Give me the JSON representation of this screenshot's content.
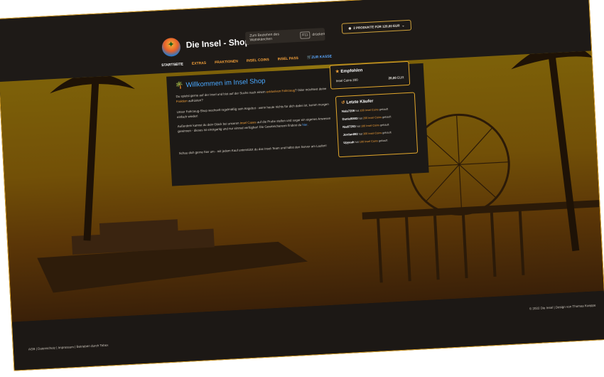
{
  "header": {
    "brand": "Die Insel - Shop",
    "logo_icon": "palm-island-logo-icon",
    "wd_text": "Zum Beziehen des Wattskänchen",
    "wd_key": "F11",
    "wd_suffix": "drücken",
    "cart_label": "2 PRODUKTE FÜR 120,00 EUR"
  },
  "nav": {
    "items": [
      {
        "label": "STARTSEITE"
      },
      {
        "label": "EXTRAS"
      },
      {
        "label": "FRAKTIONEN"
      },
      {
        "label": "INSEL COINS"
      },
      {
        "label": "INSEL PASS"
      },
      {
        "label": "ZUR KASSE"
      }
    ]
  },
  "welcome": {
    "title": "Willkommen im Insel Shop",
    "p1a": "Du spielst gerne auf der Insel und bist auf der Suche nach einem ",
    "p1link": "exklusiven Fahrzeug",
    "p1b": "? Oder möchtest deine ",
    "p1link2": "Fraktion",
    "p1c": " aufrüsten?",
    "p2": "Unser Fahrzeug-Shop wechselt regelmäßig sein Angebot - wenn heute nichts für dich dabei ist, komm morgen einfach wieder!",
    "p3a": "Außerdem kannst du dein Glück bei unseren ",
    "p3link": "Insel Cases",
    "p3b": " auf die Probe stellen und sogar ein eigenes Anwesen gewinnen - dieses ist einzigartig und nur einmal verfügbar! Die Gewinnchancen findest du ",
    "p3link2": "hier",
    "p3c": ".",
    "p4": "Schau dich gerne hier um - mit jedem Kauf unterstützt du das Insel-Team und hältst den Server am Laufen!"
  },
  "recommended": {
    "title": "Empfohlen",
    "item": "Insel Coins 200",
    "price": "20,00",
    "currency": "EUR"
  },
  "buyers": {
    "title": "Letzte Käufer",
    "rows": [
      {
        "name": "Nala7209",
        "mid": " hat ",
        "what": "100 Insel Coins",
        "end": " gekauft"
      },
      {
        "name": "Daniel6803",
        "mid": " hat ",
        "what": "200 Insel Coins",
        "end": " gekauft"
      },
      {
        "name": "Nadi7203",
        "mid": " hat ",
        "what": "100 Insel Coins",
        "end": " gekauft"
      },
      {
        "name": "Jordan892",
        "mid": " hat ",
        "what": "300 Insel Coins",
        "end": " gekauft"
      },
      {
        "name": "Upyeah",
        "mid": " hat ",
        "what": "100 Insel Coins",
        "end": " gekauft"
      }
    ]
  },
  "footer": {
    "copyright": "© 2022 Die Insel | Design von Thomas Koeppe",
    "links": "AGB | Datenschutz | Impressum | Betrieben durch Tebex"
  },
  "colors": {
    "accent": "#f4a13a",
    "link_blue": "#5aa8ff",
    "card_border": "#e2a72c"
  }
}
